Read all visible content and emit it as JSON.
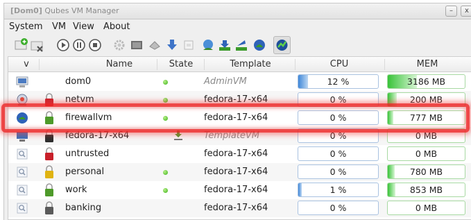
{
  "window": {
    "title_host": "[Dom0]",
    "title_app": "Qubes VM Manager",
    "minimize_glyph": "–",
    "close_glyph": "x"
  },
  "menu": {
    "items": [
      {
        "label": "System"
      },
      {
        "label": "VM"
      },
      {
        "label": "View"
      },
      {
        "label": "About"
      }
    ]
  },
  "toolbar": {
    "buttons": [
      {
        "name": "create-vm-icon"
      },
      {
        "name": "remove-vm-icon"
      },
      {
        "name": "start-vm-icon"
      },
      {
        "name": "pause-vm-icon"
      },
      {
        "name": "stop-vm-icon"
      },
      {
        "name": "settings-icon"
      },
      {
        "name": "run-command-icon"
      },
      {
        "name": "attach-device-icon"
      },
      {
        "name": "update-icon"
      },
      {
        "name": "log-icon"
      },
      {
        "name": "global-settings-icon"
      },
      {
        "name": "firewall-icon"
      },
      {
        "name": "backup-icon"
      },
      {
        "name": "restore-icon"
      },
      {
        "name": "show-cpu-icon"
      }
    ]
  },
  "table": {
    "sort_glyph": "v",
    "columns": {
      "name": "Name",
      "state": "State",
      "template": "Template",
      "cpu": "CPU",
      "mem": "MEM"
    },
    "rows": [
      {
        "name": "dom0",
        "icon": "admin-vm-icon",
        "lock": "none",
        "running": true,
        "state_icon": "dot",
        "template": "AdminVM",
        "template_italic": true,
        "cpu": "12 %",
        "cpu_fraction": 0.12,
        "mem": "3186 MB",
        "mem_fraction": 0.38,
        "selected": false
      },
      {
        "name": "netvm",
        "icon": "netvm-icon",
        "lock": "red",
        "running": true,
        "state_icon": "dot",
        "template": "fedora-17-x64",
        "template_italic": false,
        "cpu": "0 %",
        "cpu_fraction": 0,
        "mem": "200 MB",
        "mem_fraction": 0.12,
        "selected": false
      },
      {
        "name": "firewallvm",
        "icon": "firewallvm-icon",
        "lock": "green",
        "running": true,
        "state_icon": "dot",
        "template": "fedora-17-x64",
        "template_italic": false,
        "cpu": "0 %",
        "cpu_fraction": 0,
        "mem": "777 MB",
        "mem_fraction": 0.07,
        "selected": true
      },
      {
        "name": "fedora-17-x64",
        "icon": "template-vm-icon",
        "lock": "black",
        "running": false,
        "state_icon": "download",
        "template": "TemplateVM",
        "template_italic": true,
        "cpu": "0 %",
        "cpu_fraction": 0,
        "mem": "0 MB",
        "mem_fraction": 0,
        "selected": false
      },
      {
        "name": "untrusted",
        "icon": "appvm-icon",
        "lock": "red",
        "running": false,
        "state_icon": "none",
        "template": "fedora-17-x64",
        "template_italic": false,
        "cpu": "0 %",
        "cpu_fraction": 0,
        "mem": "0 MB",
        "mem_fraction": 0,
        "selected": false
      },
      {
        "name": "personal",
        "icon": "appvm-icon",
        "lock": "yellow",
        "running": true,
        "state_icon": "dot",
        "template": "fedora-17-x64",
        "template_italic": false,
        "cpu": "0 %",
        "cpu_fraction": 0,
        "mem": "780 MB",
        "mem_fraction": 0.09,
        "selected": false
      },
      {
        "name": "work",
        "icon": "appvm-icon",
        "lock": "green",
        "running": true,
        "state_icon": "dot",
        "template": "fedora-17-x64",
        "template_italic": false,
        "cpu": "1 %",
        "cpu_fraction": 0.01,
        "mem": "853 MB",
        "mem_fraction": 0.1,
        "selected": false
      },
      {
        "name": "banking",
        "icon": "appvm-icon",
        "lock": "dark-gray",
        "running": false,
        "state_icon": "none",
        "template": "fedora-17-x64",
        "template_italic": false,
        "cpu": "0 %",
        "cpu_fraction": 0,
        "mem": "0 MB",
        "mem_fraction": 0,
        "selected": false
      }
    ]
  },
  "colors": {
    "lock_red": "#c8202a",
    "lock_green": "#4e9a2a",
    "lock_yellow": "#e0b310",
    "lock_black": "#2e2e2e",
    "lock_dark-gray": "#5a5a5a",
    "lock_none": "transparent",
    "highlight": "#ec2828"
  }
}
